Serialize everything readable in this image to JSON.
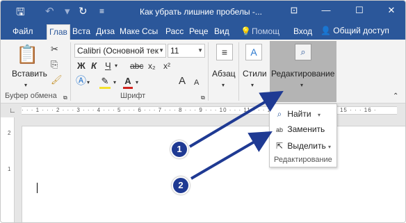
{
  "window": {
    "title": "Как убрать лишние пробелы -...",
    "qat": {
      "save_icon": "save-icon",
      "undo_icon": "undo-icon",
      "redo_icon": "redo-icon"
    }
  },
  "tabs": {
    "file": "Файл",
    "items": [
      "Глав",
      "Вста",
      "Диза",
      "Маке",
      "Ссы",
      "Расс",
      "Реце",
      "Вид"
    ],
    "help": "Помощ",
    "signin": "Вход",
    "share": "Общий доступ"
  },
  "ribbon": {
    "clipboard": {
      "paste": "Вставить",
      "label": "Буфер обмена"
    },
    "font": {
      "name": "Calibri (Основной тек",
      "size": "11",
      "bold": "Ж",
      "italic": "К",
      "underline": "Ч",
      "strike": "abc",
      "sub": "x₂",
      "sup": "x²",
      "grow": "A",
      "shrink": "A",
      "label": "Шрифт"
    },
    "paragraph": {
      "label": "Абзац"
    },
    "styles": {
      "label": "Стили"
    },
    "editing": {
      "label": "Редактирование"
    }
  },
  "dropdown": {
    "find": "Найти",
    "replace": "Заменить",
    "select": "Выделить",
    "group_label": "Редактирование"
  },
  "annotations": {
    "badge1": "1",
    "badge2": "2",
    "arrow_color": "#1f3a93"
  },
  "ruler": {
    "ticks": "· · · 1 · · · 2 · · · 3 · · · 4 · · · 5 · · · 6 · · · 7 · · · 8 · · · 9 · · · 10 · · · 11 · · · 12 · · · 13 · · · 14 · · · 15 · · · 16 ·",
    "v_tick_1": "2",
    "v_tick_2": "1"
  }
}
